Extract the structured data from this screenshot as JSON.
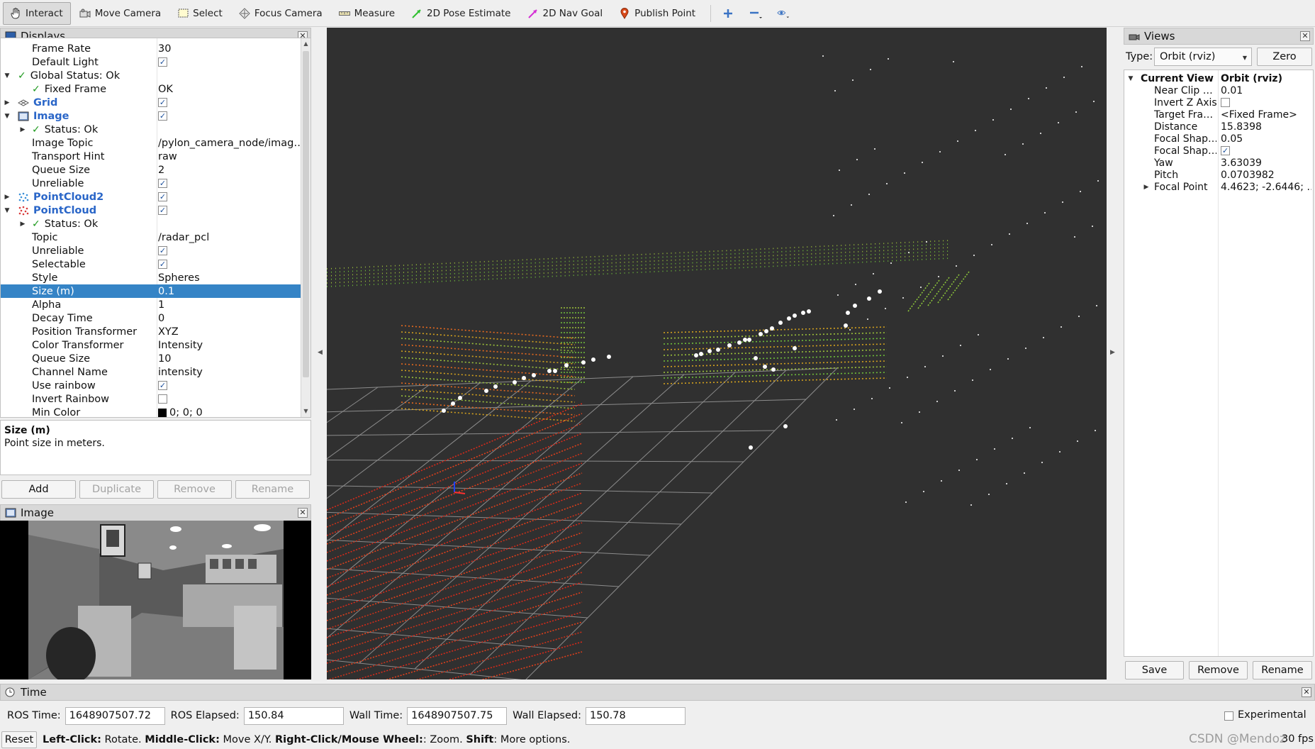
{
  "toolbar": {
    "tools": [
      {
        "label": "Interact",
        "icon": "hand-pointer-icon",
        "active": true
      },
      {
        "label": "Move Camera",
        "icon": "move-camera-icon",
        "active": false
      },
      {
        "label": "Select",
        "icon": "select-rect-icon",
        "active": false
      },
      {
        "label": "Focus Camera",
        "icon": "focus-crosshair-icon",
        "active": false
      },
      {
        "label": "Measure",
        "icon": "ruler-icon",
        "active": false
      },
      {
        "label": "2D Pose Estimate",
        "icon": "pose-arrow-icon",
        "active": false
      },
      {
        "label": "2D Nav Goal",
        "icon": "nav-arrow-icon",
        "active": false
      },
      {
        "label": "Publish Point",
        "icon": "map-pin-icon",
        "active": false
      }
    ]
  },
  "displays": {
    "title": "Displays",
    "rows": [
      {
        "label": "Frame Rate",
        "value": "30"
      },
      {
        "label": "Default Light",
        "check": true
      },
      {
        "label": "Global Status: Ok"
      },
      {
        "label": "Fixed Frame",
        "value": "OK"
      },
      {
        "label": "Grid",
        "check": true
      },
      {
        "label": "Image",
        "check": true
      },
      {
        "label": "Status: Ok"
      },
      {
        "label": "Image Topic",
        "value": "/pylon_camera_node/imag…"
      },
      {
        "label": "Transport Hint",
        "value": "raw"
      },
      {
        "label": "Queue Size",
        "value": "2"
      },
      {
        "label": "Unreliable",
        "check": true
      },
      {
        "label": "PointCloud2",
        "check": true
      },
      {
        "label": "PointCloud",
        "check": true
      },
      {
        "label": "Status: Ok"
      },
      {
        "label": "Topic",
        "value": "/radar_pcl"
      },
      {
        "label": "Unreliable",
        "check": true
      },
      {
        "label": "Selectable",
        "check": true
      },
      {
        "label": "Style",
        "value": "Spheres"
      },
      {
        "label": "Size (m)",
        "value": "0.1"
      },
      {
        "label": "Alpha",
        "value": "1"
      },
      {
        "label": "Decay Time",
        "value": "0"
      },
      {
        "label": "Position Transformer",
        "value": "XYZ"
      },
      {
        "label": "Color Transformer",
        "value": "Intensity"
      },
      {
        "label": "Queue Size",
        "value": "10"
      },
      {
        "label": "Channel Name",
        "value": "intensity"
      },
      {
        "label": "Use rainbow",
        "check": true
      },
      {
        "label": "Invert Rainbow",
        "check": false
      },
      {
        "label": "Min Color",
        "value": "0; 0; 0"
      }
    ],
    "description": {
      "title": "Size (m)",
      "text": "Point size in meters."
    },
    "buttons": {
      "add": "Add",
      "duplicate": "Duplicate",
      "remove": "Remove",
      "rename": "Rename"
    }
  },
  "image_panel": {
    "title": "Image"
  },
  "views": {
    "title": "Views",
    "type_label": "Type:",
    "type_value": "Orbit (rviz)",
    "zero": "Zero",
    "rows": [
      {
        "key": "Current View",
        "value": "Orbit (rviz)"
      },
      {
        "key": "Near Clip …",
        "value": "0.01"
      },
      {
        "key": "Invert Z Axis",
        "check": false
      },
      {
        "key": "Target Fra…",
        "value": "<Fixed Frame>"
      },
      {
        "key": "Distance",
        "value": "15.8398"
      },
      {
        "key": "Focal Shap…",
        "value": "0.05"
      },
      {
        "key": "Focal Shap…",
        "check": true
      },
      {
        "key": "Yaw",
        "value": "3.63039"
      },
      {
        "key": "Pitch",
        "value": "0.0703982"
      },
      {
        "key": "Focal Point",
        "value": "4.4623; -2.6446; …"
      }
    ],
    "buttons": {
      "save": "Save",
      "remove": "Remove",
      "rename": "Rename"
    }
  },
  "time": {
    "title": "Time",
    "ros_time_label": "ROS Time:",
    "ros_time": "1648907507.72",
    "ros_elapsed_label": "ROS Elapsed:",
    "ros_elapsed": "150.84",
    "wall_time_label": "Wall Time:",
    "wall_time": "1648907507.75",
    "wall_elapsed_label": "Wall Elapsed:",
    "wall_elapsed": "150.78",
    "experimental": "Experimental"
  },
  "status": {
    "reset": "Reset",
    "left_click": "Left-Click:",
    "left_click_text": " Rotate. ",
    "middle_click": "Middle-Click:",
    "middle_click_text": " Move X/Y. ",
    "right_click": "Right-Click/Mouse Wheel:",
    "right_click_text": ": Zoom. ",
    "shift": "Shift",
    "shift_text": ": More options.",
    "fps": "30 fps",
    "watermark": "CSDN @Mendoz"
  },
  "colors": {
    "viewport_bg": "#303030",
    "selection": "#3584c6",
    "grid": "#8c8c8c"
  }
}
